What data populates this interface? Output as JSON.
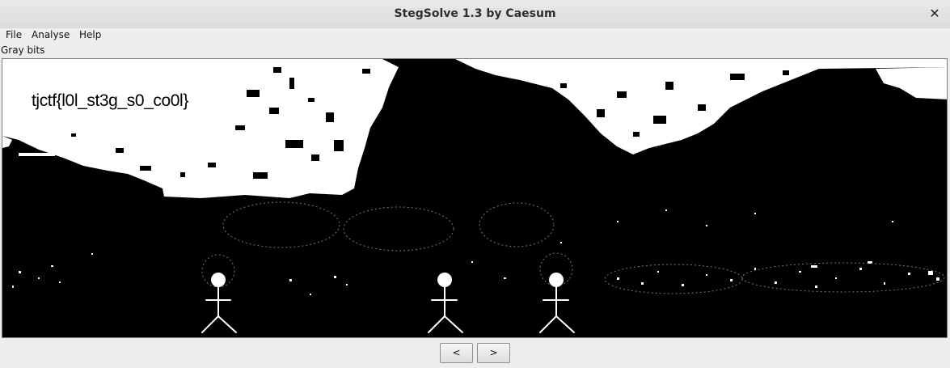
{
  "window": {
    "title": "StegSolve 1.3 by Caesum",
    "close_glyph": "✕"
  },
  "menu": {
    "items": [
      "File",
      "Analyse",
      "Help"
    ]
  },
  "view": {
    "mode_label": "Gray bits"
  },
  "image": {
    "embedded_text": "tjctf{l0l_st3g_s0_co0l}"
  },
  "nav": {
    "prev_label": "<",
    "next_label": ">"
  }
}
